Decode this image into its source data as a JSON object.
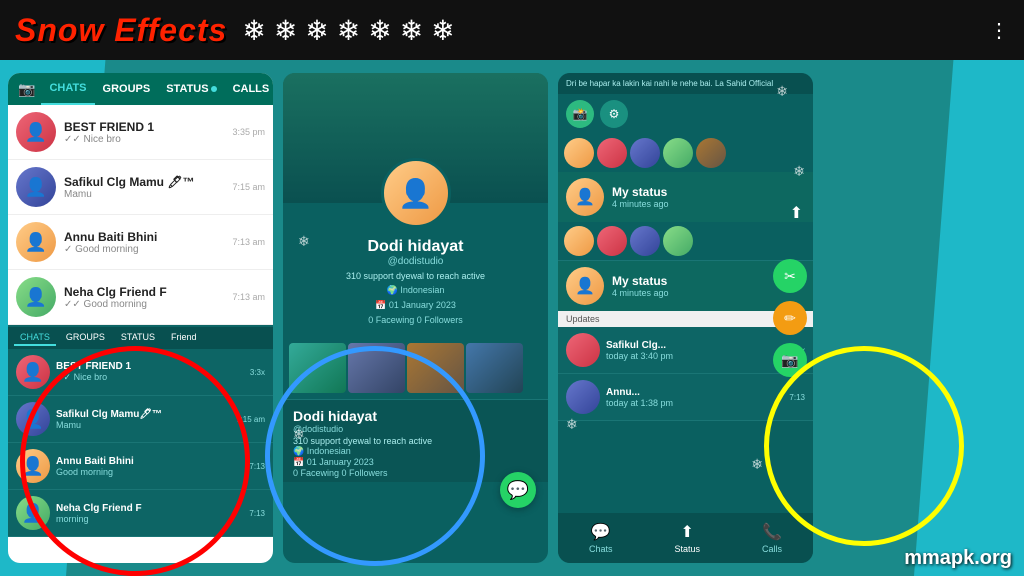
{
  "banner": {
    "title": "Snow Effects",
    "snowflakes": [
      "❄",
      "❄",
      "❄",
      "❄",
      "❄",
      "❄",
      "❄"
    ],
    "dots_icon": "⋮"
  },
  "panel1": {
    "nav_tabs": [
      "📷",
      "CHATS",
      "GROUPS",
      "STATUS",
      "CALLS"
    ],
    "chats": [
      {
        "name": "BEST FRIEND 1",
        "msg": "✓✓ Nice bro",
        "time": "3:35 pm",
        "avatar": "👤"
      },
      {
        "name": "Safikul Clg Mamu 🖊™",
        "msg": "Mamu",
        "time": "7:15 am",
        "avatar": "👤"
      },
      {
        "name": "Annu Baiti Bhini",
        "msg": "✓ Good morning",
        "time": "7:13 am",
        "avatar": "👤"
      },
      {
        "name": "Neha Clg Friend F",
        "msg": "✓✓ Good morning",
        "time": "7:13 am",
        "avatar": "👤"
      }
    ]
  },
  "panel2": {
    "profile_name": "Dodi hidayat",
    "profile_handle": "@dodistudio",
    "profile_desc": "310 support dyewal to reach active",
    "profile_location": "🌍 Indonesian",
    "profile_date": "📅 01 January 2023",
    "profile_following": "0 Facewing  0 Followers"
  },
  "panel3": {
    "my_status_label": "My status",
    "my_status_time": "4 minutes ago",
    "status_update_label": "Updates",
    "contacts": [
      {
        "name": "Safikul Clg...",
        "time": "today at 3:40 pm",
        "msg": "today at 3:40 pm"
      },
      {
        "name": "Annu Baiti Bhini",
        "time": "today at 1:38 pm",
        "msg": "today at 1:38 pm"
      }
    ],
    "bottom_nav": [
      {
        "icon": "💬",
        "label": "Chats"
      },
      {
        "icon": "⬆",
        "label": "Status"
      },
      {
        "icon": "📞",
        "label": "Calls"
      }
    ]
  },
  "brand": "mmapk.org"
}
